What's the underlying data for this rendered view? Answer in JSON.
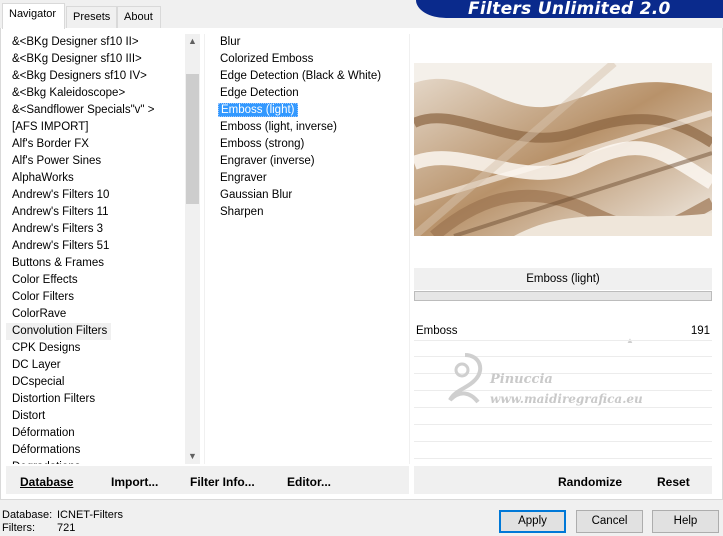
{
  "tabs": [
    "Navigator",
    "Presets",
    "About"
  ],
  "banner": "Filters Unlimited 2.0",
  "categories": [
    "&<BKg Designer sf10 II>",
    "&<BKg Designer sf10 III>",
    "&<Bkg Designers sf10 IV>",
    "&<Bkg Kaleidoscope>",
    "&<Sandflower Specials\"v\" >",
    "[AFS IMPORT]",
    "Alf's Border FX",
    "Alf's Power Sines",
    "AlphaWorks",
    "Andrew's Filters 10",
    "Andrew's Filters 11",
    "Andrew's Filters 3",
    "Andrew's Filters 51",
    "Buttons & Frames",
    "Color Effects",
    "Color Filters",
    "ColorRave",
    "Convolution Filters",
    "CPK Designs",
    "DC Layer",
    "DCspecial",
    "Distortion Filters",
    "Distort",
    "Déformation",
    "Déformations",
    "Degradations"
  ],
  "selected_category_index": 17,
  "filters": [
    "Blur",
    "Colorized Emboss",
    "Edge Detection (Black & White)",
    "Edge Detection",
    "Emboss (light)",
    "Emboss (light, inverse)",
    "Emboss (strong)",
    "Engraver (inverse)",
    "Engraver",
    "Gaussian Blur",
    "Sharpen"
  ],
  "selected_filter_index": 4,
  "preview": {
    "filter_name": "Emboss (light)",
    "control_label": "Emboss",
    "control_value": "191"
  },
  "watermark": {
    "line1": "Pinuccia",
    "line2": "www.maidiregrafica.eu"
  },
  "toolbar": {
    "database": "Database",
    "import": "Import...",
    "filter_info": "Filter Info...",
    "editor": "Editor...",
    "randomize": "Randomize",
    "reset": "Reset"
  },
  "status": {
    "database_label": "Database:",
    "database_value": "ICNET-Filters",
    "filters_label": "Filters:",
    "filters_value": "721"
  },
  "buttons": {
    "apply": "Apply",
    "cancel": "Cancel",
    "help": "Help"
  }
}
